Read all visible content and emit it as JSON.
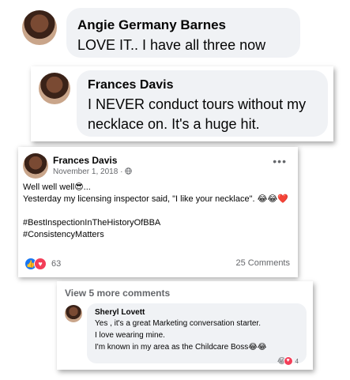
{
  "comment1": {
    "author": "Angie Germany Barnes",
    "text": "LOVE IT.. I have all three now"
  },
  "comment2": {
    "author": "Frances Davis",
    "text": "I NEVER conduct tours without my necklace on. It's a huge hit."
  },
  "post": {
    "author": "Frances Davis",
    "date": "November 1, 2018",
    "separator": "·",
    "privacy_icon": "globe-icon",
    "more_icon": "•••",
    "line1": "Well well well😎...",
    "line2": "Yesterday my licensing inspector said, \"I like your necklace\". 😂😂❤️",
    "hashtag1": "#BestInspectionInTheHistoryOfBBA",
    "hashtag2": "#ConsistencyMatters",
    "reactions": {
      "like_icon": "👍",
      "love_icon": "♥",
      "count": "63"
    },
    "comments_count": "25 Comments"
  },
  "comments_section": {
    "view_more": "View 5 more comments",
    "reply": {
      "author": "Sheryl Lovett",
      "line1": "Yes , it's a great Marketing conversation starter.",
      "line2": "I love wearing mine.",
      "line3": "I'm known in my area as the Childcare Boss😂😂",
      "reaction_count": "4"
    }
  },
  "colors": {
    "bubble": "#f0f2f5",
    "secondary_text": "#65676b",
    "like_blue": "#1877f2",
    "love_red": "#f33e58"
  }
}
